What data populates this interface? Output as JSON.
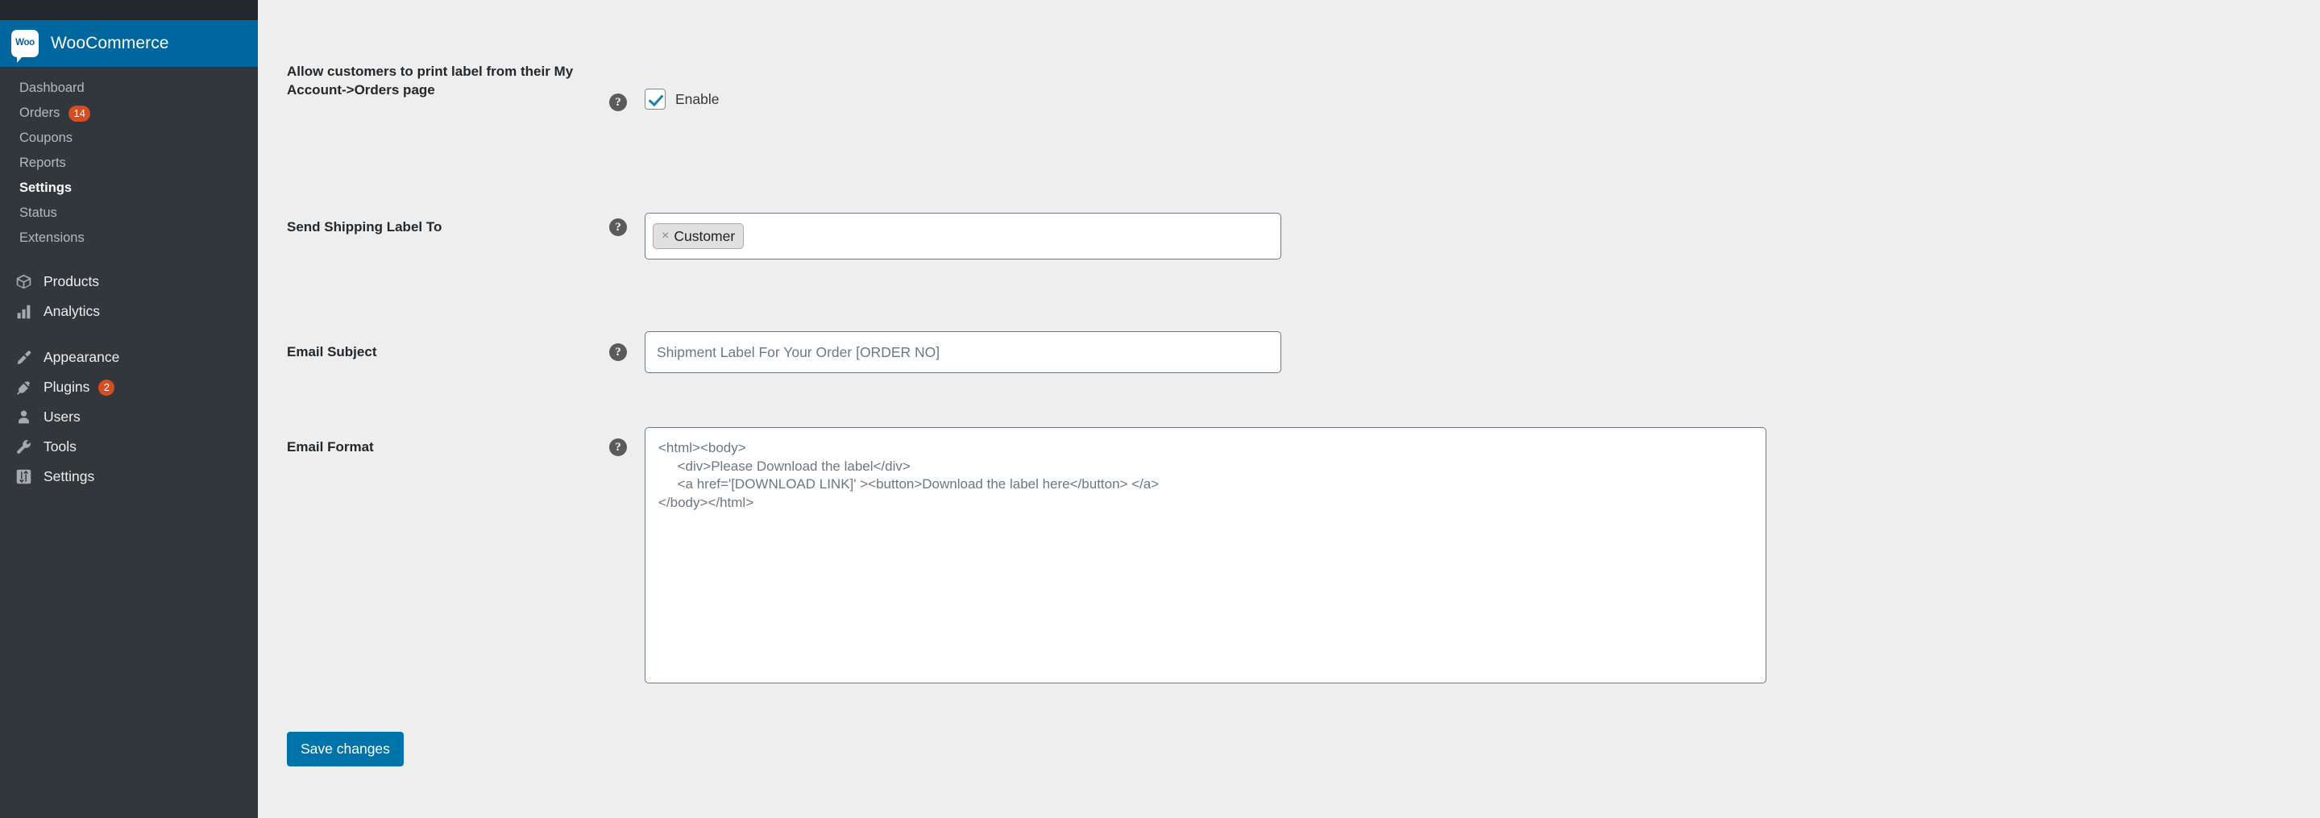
{
  "sidebar": {
    "brand": {
      "logo_text": "Woo",
      "title": "WooCommerce"
    },
    "woo_menu": [
      {
        "label": "Dashboard",
        "badge": null,
        "current": false
      },
      {
        "label": "Orders",
        "badge": "14",
        "current": false
      },
      {
        "label": "Coupons",
        "badge": null,
        "current": false
      },
      {
        "label": "Reports",
        "badge": null,
        "current": false
      },
      {
        "label": "Settings",
        "badge": null,
        "current": true
      },
      {
        "label": "Status",
        "badge": null,
        "current": false
      },
      {
        "label": "Extensions",
        "badge": null,
        "current": false
      }
    ],
    "main_menu": [
      {
        "label": "Products",
        "icon": "box-icon",
        "badge": null
      },
      {
        "label": "Analytics",
        "icon": "bar-chart-icon",
        "badge": null
      },
      {
        "label": "Appearance",
        "icon": "paintbrush-icon",
        "badge": null
      },
      {
        "label": "Plugins",
        "icon": "plug-icon",
        "badge": "2"
      },
      {
        "label": "Users",
        "icon": "user-icon",
        "badge": null
      },
      {
        "label": "Tools",
        "icon": "wrench-icon",
        "badge": null
      },
      {
        "label": "Settings",
        "icon": "sliders-icon",
        "badge": null
      }
    ]
  },
  "form": {
    "help_glyph": "?",
    "rows": {
      "print_label": {
        "label": "Allow customers to print label from their My Account->Orders page",
        "checkbox_label": "Enable",
        "checked": true
      },
      "send_label_to": {
        "label": "Send Shipping Label To",
        "tokens": [
          {
            "text": "Customer",
            "remove_glyph": "×"
          }
        ]
      },
      "email_subject": {
        "label": "Email Subject",
        "value": "Shipment Label For Your Order [ORDER NO]",
        "placeholder": "Shipment Label For Your Order [ORDER NO]"
      },
      "email_format": {
        "label": "Email Format",
        "value": "<html><body>\n     <div>Please Download the label</div>\n     <a href='[DOWNLOAD LINK]' ><button>Download the label here</button> </a>\n</body></html>",
        "placeholder": ""
      }
    },
    "save_label": "Save changes"
  },
  "colors": {
    "brand_blue": "#00669e",
    "button_blue": "#0073aa",
    "sidebar_dark": "#23282d",
    "sidebar_body": "#32373c",
    "badge_orange": "#d54e21",
    "accent_check": "#1b7eb5",
    "page_bg": "#eeeeee"
  }
}
